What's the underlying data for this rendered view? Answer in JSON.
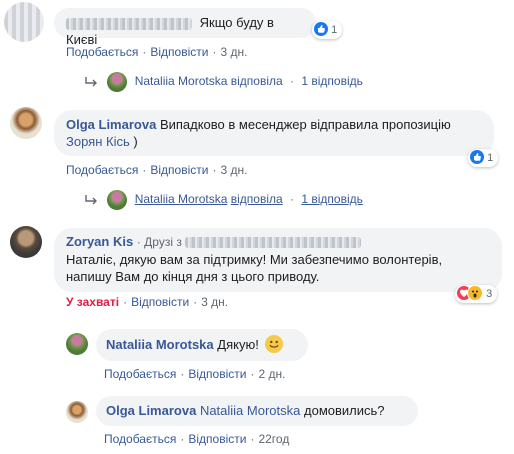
{
  "comments": [
    {
      "id": "c1",
      "text": "Якщо буду в Києві",
      "reactions_count": "1",
      "actions": {
        "like": "Подобається",
        "reply": "Відповісти",
        "time": "3 дн."
      },
      "reply_summary": {
        "author": "Nataliia Morotska",
        "verb": "відповіла",
        "count": "1 відповідь"
      }
    },
    {
      "id": "c2",
      "author": "Olga Limarova",
      "text": "Випадково в месенджер відправила пропозицію",
      "mention": "Зорян Кісь",
      "text_end": ")",
      "reactions_count": "1",
      "actions": {
        "like": "Подобається",
        "reply": "Відповісти",
        "time": "3 дн."
      },
      "reply_summary": {
        "author": "Nataliia Morotska",
        "verb": "відповіла",
        "count": "1 відповідь"
      }
    },
    {
      "id": "c3",
      "author": "Zoryan Kis",
      "meta_prefix": "Друзі з",
      "text": "Наталіє, дякую вам за підтримку! Ми забезпечимо волонтерів, напишу Вам до кінця дня з цього приводу.",
      "reactions_count": "3",
      "actions": {
        "like": "У захваті",
        "reply": "Відповісти",
        "time": "3 дн."
      }
    },
    {
      "id": "c4",
      "author": "Nataliia Morotska",
      "text": "Дякую!",
      "actions": {
        "like": "Подобається",
        "reply": "Відповісти",
        "time": "2 дн."
      }
    },
    {
      "id": "c5",
      "author": "Olga Limarova",
      "mention": "Nataliia Morotska",
      "text": "домовились?",
      "actions": {
        "like": "Подобається",
        "reply": "Відповісти",
        "time": "22год"
      }
    }
  ],
  "colors": {
    "link": "#385898",
    "bubble": "#f2f3f5",
    "like_blue": "#1877f2",
    "love_red": "#f33e58",
    "urgent_red": "#e41e3f"
  },
  "icons": {
    "reply_arrow": "reply-arrow-icon",
    "like": "like-icon",
    "love": "love-icon",
    "wow": "wow-icon",
    "smile": "smile-emoji-icon"
  }
}
